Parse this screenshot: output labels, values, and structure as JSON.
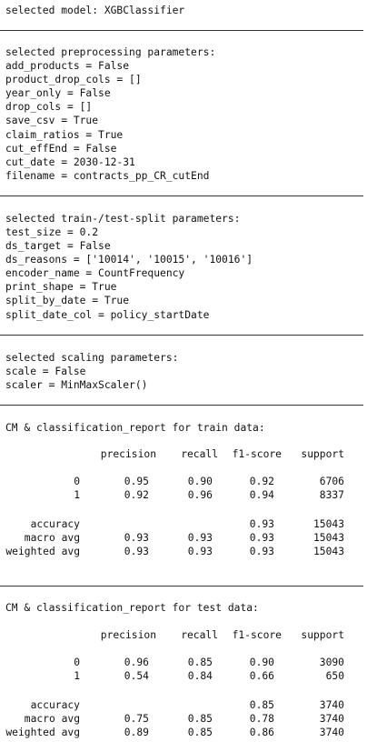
{
  "model_line": "selected model: XGBClassifier",
  "preprocessing": {
    "header": "selected preprocessing parameters:",
    "lines": [
      "add_products = False",
      "product_drop_cols = []",
      "year_only = False",
      "drop_cols = []",
      "save_csv = True",
      "claim_ratios = True",
      "cut_effEnd = False",
      "cut_date = 2030-12-31",
      "filename = contracts_pp_CR_cutEnd"
    ]
  },
  "split": {
    "header": "selected train-/test-split parameters:",
    "lines": [
      "test_size = 0.2",
      "ds_target = False",
      "ds_reasons = ['10014', '10015', '10016']",
      "encoder_name = CountFrequency",
      "print_shape = True",
      "split_by_date = True",
      "split_date_col = policy_startDate"
    ]
  },
  "scaling": {
    "header": "selected scaling parameters:",
    "lines": [
      "scale = False",
      "scaler = MinMaxScaler()"
    ]
  },
  "reports": [
    {
      "title": "CM & classification_report for train data:",
      "columns": [
        "precision",
        "recall",
        "f1-score",
        "support"
      ],
      "rows": [
        {
          "label": "0",
          "precision": "0.95",
          "recall": "0.90",
          "f1": "0.92",
          "support": "6706"
        },
        {
          "label": "1",
          "precision": "0.92",
          "recall": "0.96",
          "f1": "0.94",
          "support": "8337"
        },
        {
          "label": "accuracy",
          "precision": "",
          "recall": "",
          "f1": "0.93",
          "support": "15043"
        },
        {
          "label": "macro avg",
          "precision": "0.93",
          "recall": "0.93",
          "f1": "0.93",
          "support": "15043"
        },
        {
          "label": "weighted avg",
          "precision": "0.93",
          "recall": "0.93",
          "f1": "0.93",
          "support": "15043"
        }
      ]
    },
    {
      "title": "CM & classification_report for test data:",
      "columns": [
        "precision",
        "recall",
        "f1-score",
        "support"
      ],
      "rows": [
        {
          "label": "0",
          "precision": "0.96",
          "recall": "0.85",
          "f1": "0.90",
          "support": "3090"
        },
        {
          "label": "1",
          "precision": "0.54",
          "recall": "0.84",
          "f1": "0.66",
          "support": "650"
        },
        {
          "label": "accuracy",
          "precision": "",
          "recall": "",
          "f1": "0.85",
          "support": "3740"
        },
        {
          "label": "macro avg",
          "precision": "0.75",
          "recall": "0.85",
          "f1": "0.78",
          "support": "3740"
        },
        {
          "label": "weighted avg",
          "precision": "0.89",
          "recall": "0.85",
          "f1": "0.86",
          "support": "3740"
        }
      ]
    }
  ]
}
